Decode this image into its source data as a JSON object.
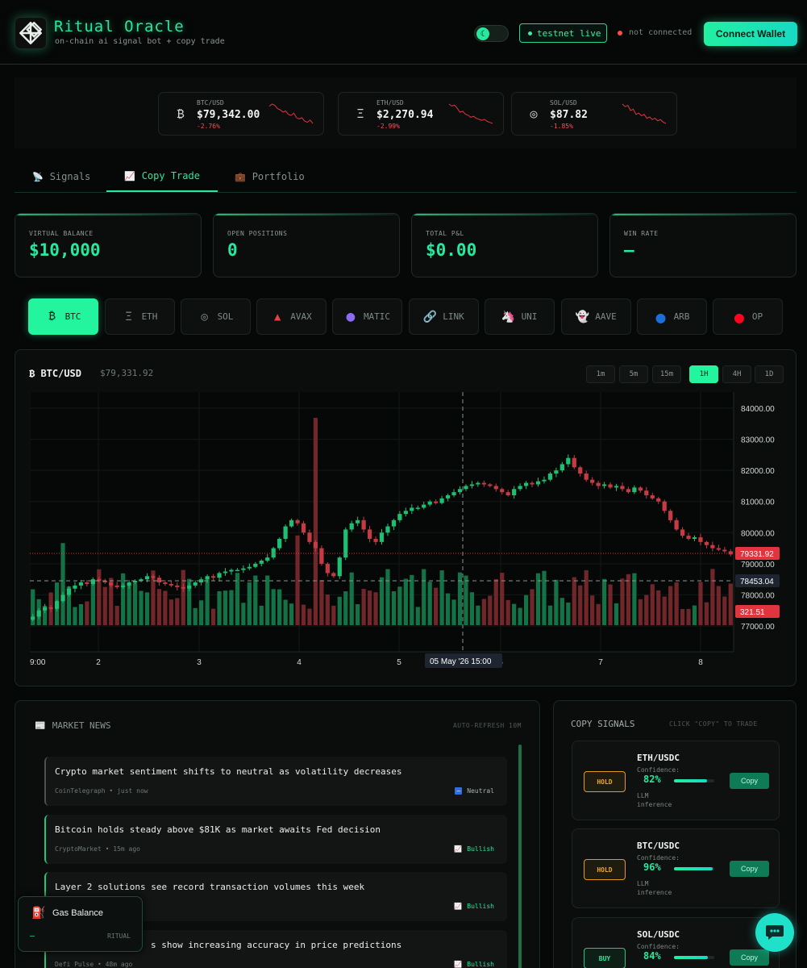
{
  "app": {
    "title": "Ritual Oracle",
    "subtitle": "on-chain ai signal bot + copy trade",
    "network_badge": "testnet live",
    "connection_status": "not connected",
    "connect_button": "Connect Wallet",
    "theme_icon": "moon-icon"
  },
  "tickers": [
    {
      "pair": "BTC/USD",
      "price": "$79,342.00",
      "change": "-2.76%",
      "icon": "bitcoin-icon",
      "glyph": "₿",
      "spark": [
        12,
        10,
        11,
        14,
        15,
        17,
        16,
        19,
        20,
        18,
        22,
        23,
        22,
        25,
        26,
        24,
        27
      ]
    },
    {
      "pair": "ETH/USD",
      "price": "$2,270.94",
      "change": "-2.99%",
      "icon": "ethereum-icon",
      "glyph": "Ξ",
      "spark": [
        8,
        10,
        9,
        12,
        16,
        15,
        18,
        19,
        21,
        20,
        22,
        23,
        24,
        23,
        25,
        26,
        27
      ]
    },
    {
      "pair": "SOL/USD",
      "price": "$87.82",
      "change": "-1.85%",
      "icon": "solana-icon",
      "glyph": "◎",
      "spark": [
        10,
        12,
        11,
        15,
        14,
        18,
        17,
        19,
        18,
        21,
        20,
        22,
        21,
        23,
        22,
        24,
        25
      ]
    }
  ],
  "tabs": [
    {
      "label": "Signals",
      "icon": "satellite-icon",
      "glyph": "📡"
    },
    {
      "label": "Copy Trade",
      "icon": "chart-icon",
      "glyph": "📈"
    },
    {
      "label": "Portfolio",
      "icon": "briefcase-icon",
      "glyph": "💼"
    }
  ],
  "stats": [
    {
      "label": "VIRTUAL BALANCE",
      "value": "$10,000"
    },
    {
      "label": "OPEN POSITIONS",
      "value": "0"
    },
    {
      "label": "TOTAL P&L",
      "value": "$0.00"
    },
    {
      "label": "WIN RATE",
      "value": "—"
    }
  ],
  "assets": [
    {
      "label": "BTC",
      "icon": "bitcoin-icon",
      "glyph": "₿",
      "color": "#062016"
    },
    {
      "label": "ETH",
      "icon": "ethereum-icon",
      "glyph": "Ξ",
      "color": "#9aa3a0"
    },
    {
      "label": "SOL",
      "icon": "solana-icon",
      "glyph": "◎",
      "color": "#9aa3a0"
    },
    {
      "label": "AVAX",
      "icon": "avalanche-icon",
      "glyph": "▲",
      "color": "#e84142"
    },
    {
      "label": "MATIC",
      "icon": "polygon-icon",
      "glyph": "●",
      "color": "#8247e5"
    },
    {
      "label": "LINK",
      "icon": "link-icon",
      "glyph": "🔗",
      "color": "#9aa3a0"
    },
    {
      "label": "UNI",
      "icon": "unicorn-icon",
      "glyph": "🦄",
      "color": "#ff007a"
    },
    {
      "label": "AAVE",
      "icon": "ghost-icon",
      "glyph": "👻",
      "color": "#b6509e"
    },
    {
      "label": "ARB",
      "icon": "arbitrum-icon",
      "glyph": "●",
      "color": "#1b6fd8"
    },
    {
      "label": "OP",
      "icon": "optimism-icon",
      "glyph": "●",
      "color": "#ff0420"
    }
  ],
  "chart": {
    "title": "BTC/USD",
    "price": "$79,331.92",
    "timeframes": [
      "1m",
      "5m",
      "15m",
      "1H",
      "4H",
      "1D"
    ],
    "active_timeframe": "1H"
  },
  "chart_data": {
    "type": "candlestick",
    "ylim": [
      77000,
      84000
    ],
    "y_ticks": [
      "84000.00",
      "83000.00",
      "82000.00",
      "81000.00",
      "80000.00",
      "79000.00",
      "78000.00",
      "77000.00"
    ],
    "x_ticks": [
      "9:00",
      "2",
      "3",
      "4",
      "5",
      "6",
      "7",
      "8"
    ],
    "last_price_label": "79331.92",
    "crosshair_price_label": "78453.04",
    "volume_label": "321.51",
    "crosshair_time_label": "05 May '26   15:00",
    "closes": [
      77300,
      77500,
      77600,
      77550,
      77800,
      78000,
      78200,
      78300,
      78400,
      78350,
      78500,
      78450,
      78400,
      78300,
      78250,
      78300,
      78400,
      78450,
      78500,
      78600,
      78550,
      78400,
      78350,
      78300,
      78250,
      78200,
      78300,
      78400,
      78500,
      78600,
      78550,
      78700,
      78750,
      78800,
      78800,
      78850,
      78900,
      79000,
      79100,
      79200,
      79500,
      79800,
      80200,
      80400,
      80300,
      80000,
      79700,
      79500,
      79000,
      78700,
      78600,
      79200,
      80100,
      80300,
      80400,
      80100,
      79800,
      79700,
      80000,
      80200,
      80400,
      80600,
      80700,
      80800,
      80800,
      80900,
      81000,
      80950,
      81100,
      81200,
      81300,
      81400,
      81500,
      81550,
      81600,
      81550,
      81500,
      81400,
      81300,
      81200,
      81400,
      81500,
      81600,
      81550,
      81650,
      81700,
      81900,
      82000,
      82200,
      82400,
      82100,
      81900,
      81700,
      81600,
      81500,
      81550,
      81450,
      81500,
      81400,
      81300,
      81450,
      81350,
      81200,
      81100,
      81000,
      80700,
      80400,
      80100,
      79900,
      79800,
      79850,
      79700,
      79600,
      79500,
      79450,
      79400,
      79300
    ]
  },
  "news": {
    "title": "MARKET NEWS",
    "icon": "newspaper-icon",
    "refresh": "AUTO-REFRESH 10M",
    "items": [
      {
        "title": "Crypto market sentiment shifts to neutral as volatility decreases",
        "meta": "CoinTelegraph • just now",
        "sentiment": "Neutral",
        "sentiment_icon": "neutral-icon"
      },
      {
        "title": "Bitcoin holds steady above $81K as market awaits Fed decision",
        "meta": "CryptoMarket • 15m ago",
        "sentiment": "Bullish",
        "sentiment_icon": "trend-up-icon"
      },
      {
        "title": "Layer 2 solutions see record transaction volumes this week",
        "meta": "",
        "sentiment": "Bullish",
        "sentiment_icon": "trend-up-icon"
      },
      {
        "title": "s show increasing accuracy in price predictions",
        "meta": "Defi Pulse • 48m ago",
        "sentiment": "Bullish",
        "sentiment_icon": "trend-up-icon"
      }
    ]
  },
  "signals": {
    "title": "COPY SIGNALS",
    "hint": "CLICK \"COPY\" TO TRADE",
    "items": [
      {
        "pair": "ETH/USDC",
        "action": "HOLD",
        "confidence_label": "Confidence:",
        "confidence": "82%",
        "confidence_value": 0.82,
        "model": "LLM inference",
        "copy": "Copy"
      },
      {
        "pair": "BTC/USDC",
        "action": "HOLD",
        "confidence_label": "Confidence:",
        "confidence": "96%",
        "confidence_value": 0.96,
        "model": "LLM inference",
        "copy": "Copy"
      },
      {
        "pair": "SOL/USDC",
        "action": "BUY",
        "confidence_label": "Confidence:",
        "confidence": "84%",
        "confidence_value": 0.84,
        "model": "",
        "copy": "Copy"
      }
    ]
  },
  "gas": {
    "title": "Gas Balance",
    "value": "—",
    "unit": "RITUAL",
    "icon": "fuel-icon"
  },
  "colors": {
    "accent": "#27e89d",
    "up": "#1fa868",
    "down": "#b3363d",
    "hold": "#eda624"
  }
}
